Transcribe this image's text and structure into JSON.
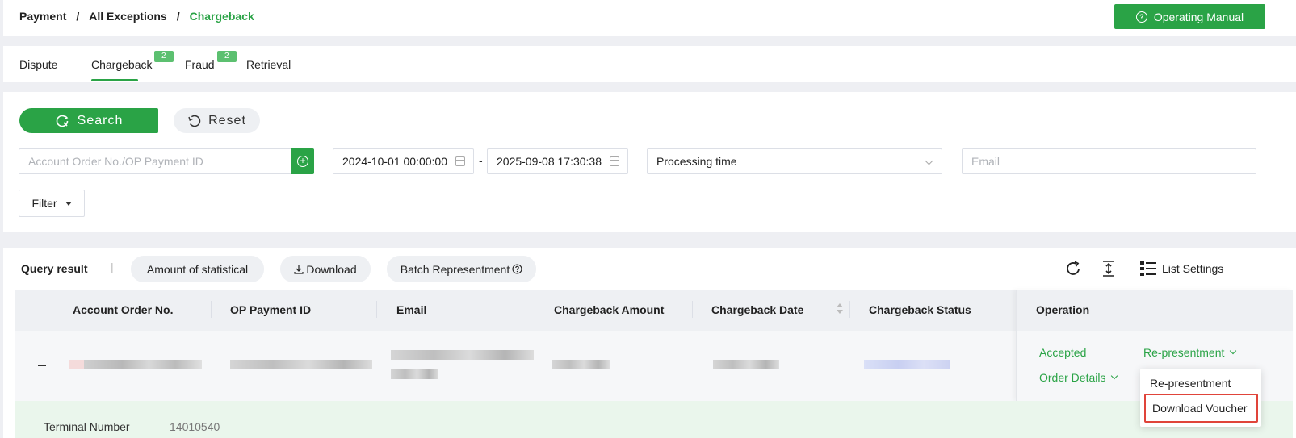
{
  "breadcrumb": {
    "items": [
      "Payment",
      "All Exceptions",
      "Chargeback"
    ],
    "separator": "/"
  },
  "header": {
    "manual_label": "Operating Manual"
  },
  "tabs": [
    {
      "label": "Dispute",
      "badge": ""
    },
    {
      "label": "Chargeback",
      "badge": "2"
    },
    {
      "label": "Fraud",
      "badge": "2"
    },
    {
      "label": "Retrieval",
      "badge": ""
    }
  ],
  "search": {
    "search_label": "Search",
    "reset_label": "Reset",
    "order_placeholder": "Account Order No./OP Payment ID",
    "date_from": "2024-10-01 00:00:00",
    "date_to": "2025-09-08 17:30:38",
    "date_sep": "-",
    "time_type": "Processing time",
    "email_placeholder": "Email",
    "filter_label": "Filter"
  },
  "results": {
    "title": "Query result",
    "divider": "|",
    "stat_label": "Amount of statistical",
    "download_label": "Download",
    "batch_label": "Batch Representment",
    "list_settings_label": "List Settings"
  },
  "table": {
    "columns": [
      "Account Order No.",
      "OP Payment ID",
      "Email",
      "Chargeback Amount",
      "Chargeback Date",
      "Chargeback Status",
      "Operation"
    ],
    "row": {
      "status_link": "Accepted",
      "represent_link": "Re-presentment",
      "details_link": "Order Details"
    },
    "expand": {
      "terminal_label": "Terminal Number",
      "terminal_value": "14010540"
    }
  },
  "dropdown": {
    "items": [
      "Re-presentment",
      "Download Voucher"
    ]
  },
  "colors": {
    "accent": "#2aa346",
    "highlight": "#e0443a",
    "badge": "#5cc070"
  }
}
